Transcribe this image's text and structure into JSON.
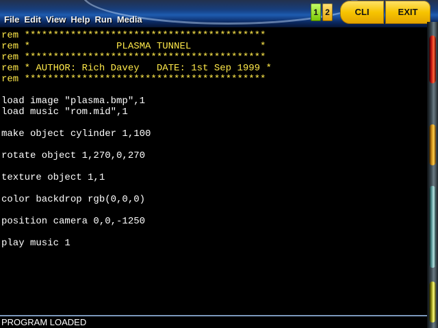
{
  "menubar": {
    "items": [
      {
        "label": "File"
      },
      {
        "label": "Edit"
      },
      {
        "label": "View"
      },
      {
        "label": "Help"
      },
      {
        "label": "Run"
      },
      {
        "label": "Media"
      }
    ]
  },
  "toolbar": {
    "btn1_label": "1",
    "btn2_label": "2",
    "cli_label": "CLI",
    "exit_label": "EXIT"
  },
  "editor": {
    "lines": [
      "rem ******************************************",
      "rem *               PLASMA TUNNEL            *",
      "rem ******************************************",
      "rem * AUTHOR: Rich Davey   DATE: 1st Sep 1999 *",
      "rem ******************************************",
      "",
      "load image \"plasma.bmp\",1",
      "load music \"rom.mid\",1",
      "",
      "make object cylinder 1,100",
      "",
      "rotate object 1,270,0,270",
      "",
      "texture object 1,1",
      "",
      "color backdrop rgb(0,0,0)",
      "",
      "position camera 0,0,-1250",
      "",
      "play music 1"
    ]
  },
  "status": {
    "text": "PROGRAM LOADED"
  },
  "colors": {
    "rem_text": "#ffe94a",
    "code_text": "#ffffff",
    "editor_bg": "#000000",
    "button_yellow": "#f7c400"
  }
}
